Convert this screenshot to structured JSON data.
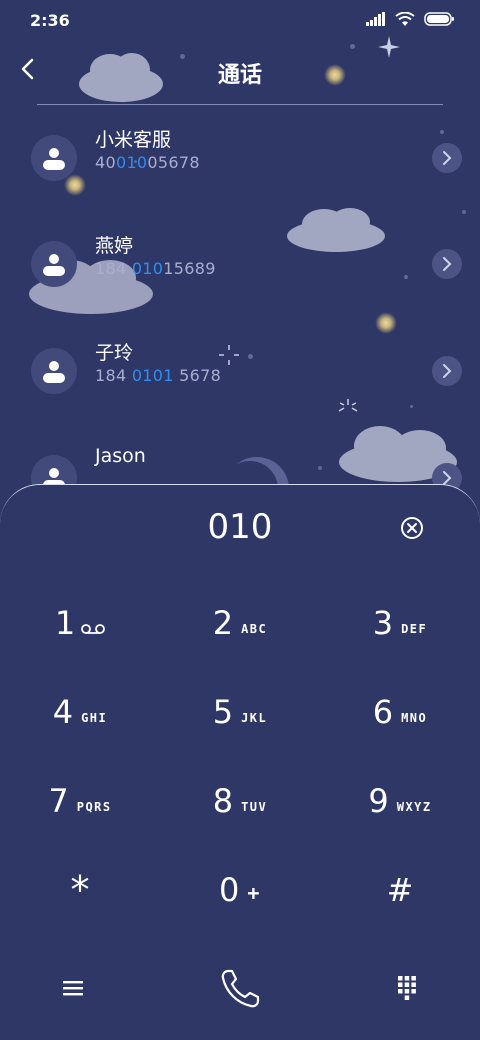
{
  "status": {
    "time": "2:36"
  },
  "header": {
    "title": "通话"
  },
  "contacts": [
    {
      "name": "小米客服",
      "number_pre": "40",
      "number_hl": "010",
      "number_post": "05678"
    },
    {
      "name": "燕婷",
      "number_pre": "184 ",
      "number_hl": "010",
      "number_post": "15689"
    },
    {
      "name": "子玲",
      "number_pre": "184 ",
      "number_hl": "0101",
      "number_post": " 5678"
    },
    {
      "name": "Jason",
      "number_pre": "",
      "number_hl": "",
      "number_post": ""
    }
  ],
  "dialer": {
    "input": "010",
    "keys": [
      {
        "digit": "1",
        "sub": ""
      },
      {
        "digit": "2",
        "sub": "ABC"
      },
      {
        "digit": "3",
        "sub": "DEF"
      },
      {
        "digit": "4",
        "sub": "GHI"
      },
      {
        "digit": "5",
        "sub": "JKL"
      },
      {
        "digit": "6",
        "sub": "MNO"
      },
      {
        "digit": "7",
        "sub": "PQRS"
      },
      {
        "digit": "8",
        "sub": "TUV"
      },
      {
        "digit": "9",
        "sub": "WXYZ"
      },
      {
        "digit": "*",
        "sub": ""
      },
      {
        "digit": "0",
        "sub": "+"
      },
      {
        "digit": "#",
        "sub": ""
      }
    ]
  },
  "icons": {
    "back": "chevron-left-icon",
    "clear": "clear-circle-icon",
    "voicemail": "voicemail-icon",
    "menu": "menu-icon",
    "call": "phone-icon",
    "keypad": "keypad-icon"
  },
  "colors": {
    "background": "#2e3766",
    "highlight": "#2f8ef0",
    "number_text": "#a9aed0"
  }
}
